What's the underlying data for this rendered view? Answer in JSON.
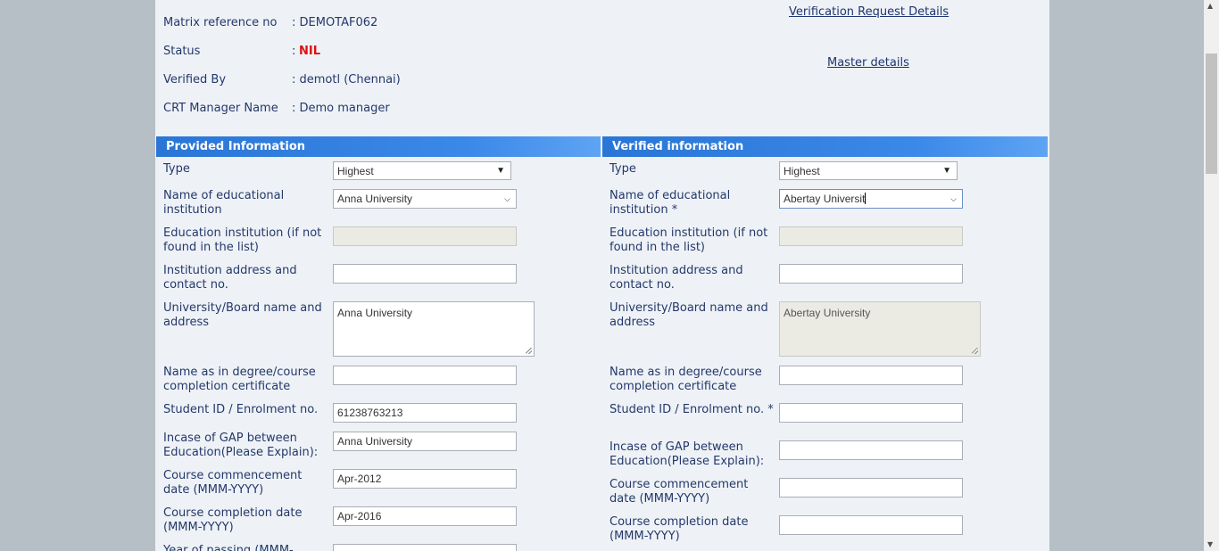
{
  "header": {
    "matrix_label": "Matrix reference no",
    "matrix_value": ":  DEMOTAF062",
    "status_label": "Status",
    "status_colon": ":",
    "status_value": "NIL",
    "verified_label": "Verified By",
    "verified_value": ": demotl (Chennai)",
    "crt_label": "CRT Manager Name",
    "crt_value": ": Demo manager",
    "link_verification": "Verification Request Details",
    "link_master": "Master details"
  },
  "provided": {
    "title": "Provided Information",
    "type_label": "Type",
    "type_value": "Highest",
    "institution_label": "Name of educational institution",
    "institution_value": "Anna University",
    "inst_other_label": "Education institution (if not found in the list)",
    "address_label": "Institution address and contact no.",
    "address_value": "",
    "university_label": "University/Board name and address",
    "university_value": "Anna University",
    "name_cert_label": "Name as in degree/course completion certificate",
    "name_cert_value": "",
    "student_id_label": "Student ID / Enrolment no.",
    "student_id_value": "61238763213",
    "gap_label": "Incase of GAP between Education(Please Explain):",
    "gap_value": "Anna University",
    "commence_label": "Course commencement date (MMM-YYYY)",
    "commence_value": "Apr-2012",
    "completion_label": "Course completion date (MMM-YYYY)",
    "completion_value": "Apr-2016",
    "year_label": "Year of passing (MMM-"
  },
  "verified": {
    "title": "Verified information",
    "type_label": "Type",
    "type_value": "Highest",
    "institution_label": "Name of educational institution *",
    "institution_value": "Abertay Universit",
    "inst_other_label": "Education institution (if not found in the list)",
    "address_label": "Institution address and contact no.",
    "university_label": "University/Board name and address",
    "university_value": "Abertay University",
    "name_cert_label": "Name as in degree/course completion certificate",
    "student_id_label": "Student ID / Enrolment no. *",
    "gap_label": "Incase of GAP between Education(Please Explain):",
    "commence_label": "Course commencement date (MMM-YYYY)",
    "completion_label": "Course completion date (MMM-YYYY)"
  },
  "icons": {
    "dropdown": "chevron-down-icon",
    "scroll_up": "triangle-up-icon",
    "scroll_down": "triangle-down-icon"
  },
  "colors": {
    "header_bar": "#3a88e8",
    "status_nil": "#e01010",
    "label_text": "#24386b",
    "page_bg": "#eef2f6"
  }
}
